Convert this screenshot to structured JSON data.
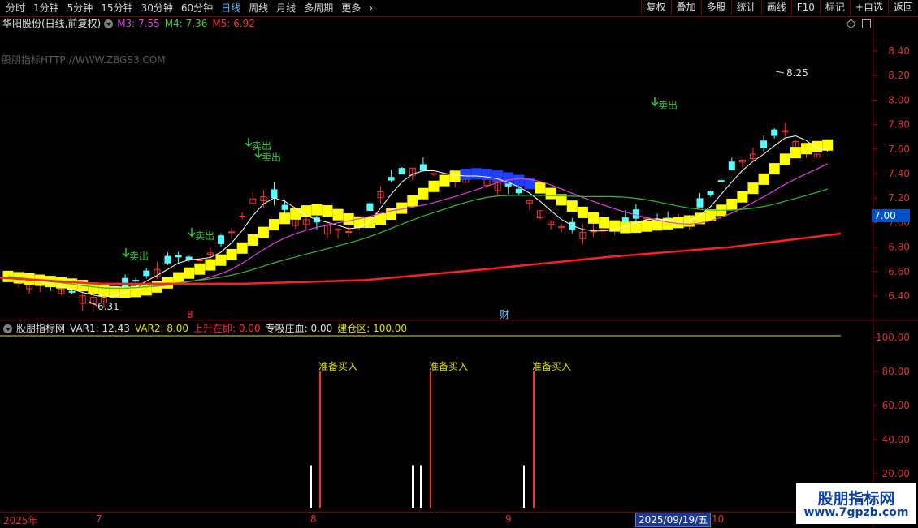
{
  "toolbar": {
    "tabs": [
      "分时",
      "1分钟",
      "5分钟",
      "15分钟",
      "30分钟",
      "60分钟",
      "日线",
      "周线",
      "月线",
      "多周期",
      "更多"
    ],
    "active_tab": "日线",
    "buttons": [
      "复权",
      "叠加",
      "多股",
      "统计",
      "画线",
      "F10",
      "标记",
      "+自选",
      "返回"
    ]
  },
  "title": {
    "stock": "华阳股份(日线,前复权)",
    "ma": [
      {
        "label": "M3: 7.55",
        "color": "#e040e0"
      },
      {
        "label": "M4: 7.36",
        "color": "#40d040"
      },
      {
        "label": "M5: 6.92",
        "color": "#ff3030"
      }
    ]
  },
  "watermark": "股朋指标HTTP://WWW.ZBGS3.COM",
  "main_axis": [
    "8.40",
    "8.20",
    "8.00",
    "7.80",
    "7.60",
    "7.40",
    "7.20",
    "7.00",
    "6.80",
    "6.60",
    "6.40"
  ],
  "current_price": "7.00",
  "annotations": {
    "high": "8.25",
    "low": "6.31",
    "sell": "卖出",
    "event_red": "8",
    "event_finance": "财"
  },
  "indicator": {
    "name": "股朋指标网",
    "items": [
      {
        "label": "VAR1: 12.43",
        "color": "#e0e0e0"
      },
      {
        "label": "VAR2: 8.00",
        "color": "#e0e000"
      },
      {
        "label": "上升在即: 0.00",
        "color": "#ff3030"
      },
      {
        "label": "专吸庄血: 0.00",
        "color": "#e0e0e0"
      },
      {
        "label": "建仓区: 100.00",
        "color": "#e0e000"
      }
    ],
    "axis": [
      "100.00",
      "80.00",
      "60.00",
      "40.00",
      "20.00"
    ],
    "signal_label": "准备买入"
  },
  "time_axis": [
    "2025年",
    "7",
    "8",
    "9",
    "10"
  ],
  "selected_date": "2025/09/19/五",
  "brand": {
    "title": "股朋指标网",
    "url": "www.7gpzb.com"
  },
  "colors": {
    "up": "#ff3030",
    "down": "#54ffff",
    "band": "#ffff00",
    "ma_white": "#ffffff",
    "ma_purple": "#e040e0",
    "ma_green": "#30c030",
    "ma_red": "#ff2020"
  }
}
